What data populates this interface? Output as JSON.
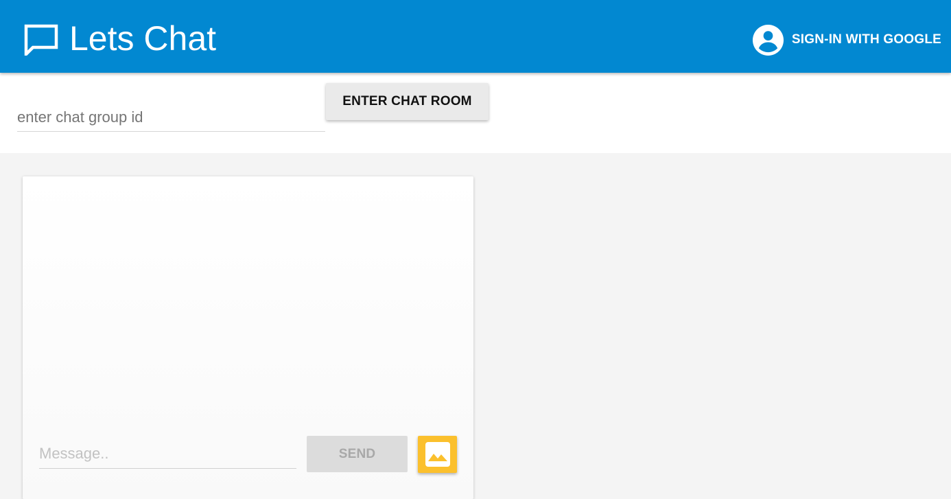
{
  "header": {
    "app_icon": "chat-bubble-icon",
    "title": "Lets Chat",
    "signin_icon": "account-circle-icon",
    "signin_label": "SIGN-IN WITH GOOGLE",
    "background_color": "#0288d1"
  },
  "entry": {
    "group_id_placeholder": "enter chat group id",
    "group_id_value": "",
    "enter_button_label": "ENTER CHAT ROOM"
  },
  "chat": {
    "message_placeholder": "Message..",
    "message_value": "",
    "send_label": "SEND",
    "image_button_icon": "image-icon",
    "image_button_color": "#fbc02d"
  }
}
